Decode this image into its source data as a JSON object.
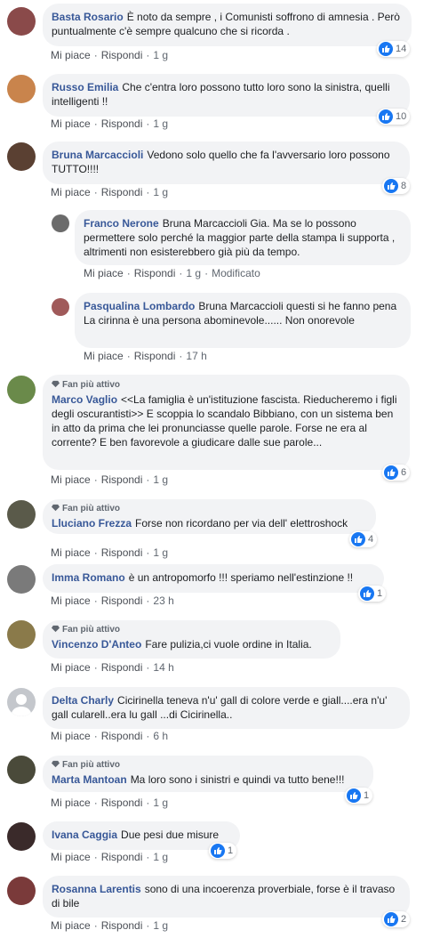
{
  "labels": {
    "like": "Mi piace",
    "reply": "Rispondi",
    "top_fan": "Fan più attivo",
    "edited": "Modificato"
  },
  "comments": [
    {
      "author": "Basta Rosario",
      "text": "È noto da sempre , i Comunisti soffrono di amnesia . Però puntualmente c'è sempre qualcuno che si ricorda .",
      "time": "1 g",
      "likes": "14",
      "avatar_color": "#8a4a4a"
    },
    {
      "author": "Russo Emilia",
      "text": "Che c'entra loro possono tutto loro sono la sinistra, quelli intelligenti !!",
      "time": "1 g",
      "likes": "10",
      "avatar_color": "#c9844c"
    },
    {
      "author": "Bruna Marcaccioli",
      "text": "Vedono solo quello che fa l'avversario loro possono TUTTO!!!!",
      "time": "1 g",
      "likes": "8",
      "avatar_color": "#5a4032"
    },
    {
      "author": "Franco Nerone",
      "text": "Bruna Marcaccioli Gia. Ma se lo possono permettere solo perché la maggior parte della stampa li supporta , altrimenti non esisterebbero già più da tempo.",
      "time": "1 g",
      "edited": true,
      "avatar_color": "#6b6b6b"
    },
    {
      "author": "Pasqualina Lombardo",
      "text": "Bruna Marcaccioli questi si he fanno pena\nLa cirinna è una persona abominevole...... Non onorevole",
      "time": "17 h",
      "avatar_color": "#a05a5a"
    },
    {
      "author": "Marco Vaglio",
      "text": "<<La famiglia è un'istituzione fascista. Rieducheremo i figli degli oscurantisti>> E scoppia lo scandalo Bibbiano, con un sistema ben in atto da prima che lei pronunciasse quelle parole. Forse ne era al corrente? E ben favorevole a giudicare dalle sue parole...",
      "time": "1 g",
      "likes": "6",
      "top_fan": true,
      "avatar_color": "#6a8a4a"
    },
    {
      "author": "Lluciano Frezza",
      "text": "Forse non ricordano per via dell' elettroshock",
      "time": "1 g",
      "likes": "4",
      "top_fan": true,
      "avatar_color": "#5a5a4a"
    },
    {
      "author": "Imma Romano",
      "text": "è un antropomorfo !!! speriamo nell'estinzione !!",
      "time": "23 h",
      "likes": "1",
      "avatar_color": "#7a7a7a"
    },
    {
      "author": "Vincenzo D'Anteo",
      "text": "Fare pulizia,ci vuole ordine in Italia.",
      "time": "14 h",
      "top_fan": true,
      "avatar_color": "#8a7a4a"
    },
    {
      "author": "Delta Charly",
      "text": "Cicirinella teneva n'u' gall di colore verde e giall....era n'u' gall cularell..era lu gall ...di Cicirinella..",
      "time": "6 h",
      "avatar_color": "#c4c7cc"
    },
    {
      "author": "Marta Mantoan",
      "text": "Ma loro sono i sinistri e quindi va tutto bene!!!",
      "time": "1 g",
      "likes": "1",
      "top_fan": true,
      "avatar_color": "#4a4a3a"
    },
    {
      "author": "Ivana Caggia",
      "text": "Due pesi due misure",
      "time": "1 g",
      "likes": "1",
      "avatar_color": "#3a2a2a"
    },
    {
      "author": "Rosanna Larentis",
      "text": "sono di una incoerenza proverbiale, forse è il travaso di bile",
      "time": "1 g",
      "likes": "2",
      "avatar_color": "#7a3a3a"
    }
  ]
}
